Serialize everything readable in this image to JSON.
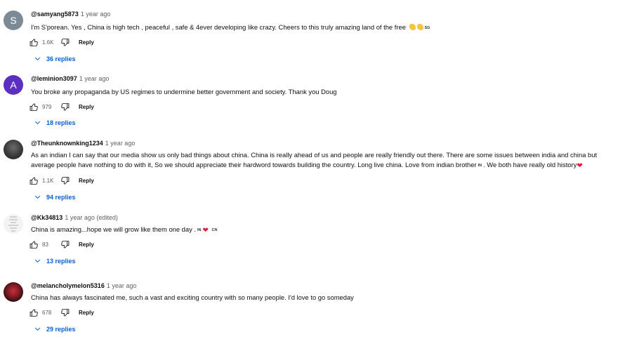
{
  "comments": [
    {
      "handle": "@samyang5873",
      "time": "1 year ago",
      "avatar_letter": "S",
      "text": "I'm S'porean. Yes , China is high tech , peaceful , safe & 4ever developing like crazy. Cheers to this truly amazing land of the free",
      "flag": "SG",
      "likes": "1.6K",
      "reply_label": "Reply",
      "replies_label": "36 replies"
    },
    {
      "handle": "@leminion3097",
      "time": "1 year ago",
      "avatar_letter": "A",
      "text": "You broke any propaganda by US regimes to undermine better government and society. Thank you Doug",
      "likes": "979",
      "reply_label": "Reply",
      "replies_label": "18 replies"
    },
    {
      "handle": "@Theunknownking1234",
      "time": "1 year ago",
      "text_line1": "As an indian I can say that our media show us  only bad things about china. China is really ahead of us and people are really friendly out there. There are some issues between india and china but",
      "text_line2a": "average people have nothing to do with it, So we should appreciate their hardword towards building the country. Long live china. Love from indian brother",
      "flag": "IN",
      "text_line2b": ". We both have really old history",
      "likes": "1.1K",
      "reply_label": "Reply",
      "replies_label": "94 replies"
    },
    {
      "handle": "@Kk34813",
      "time": "1 year ago (edited)",
      "text": "China is amazing...hope we will grow like them one day .",
      "flag1": "IN",
      "flag2": "CN",
      "likes": "83",
      "reply_label": "Reply",
      "replies_label": "13 replies"
    },
    {
      "handle": "@melancholymelon5316",
      "time": "1 year ago",
      "text": "China has always fascinated me, such a vast and exciting country with so many people. I'd love to go someday",
      "likes": "678",
      "reply_label": "Reply",
      "replies_label": "29 replies"
    }
  ],
  "colors": {
    "link_blue": "#065fd4",
    "meta_gray": "#606060",
    "heart_red": "#e0213a"
  },
  "icons": [
    "thumb-up-icon",
    "thumb-down-icon",
    "chevron-down-icon",
    "clapping-hands-icon",
    "red-heart-icon"
  ]
}
